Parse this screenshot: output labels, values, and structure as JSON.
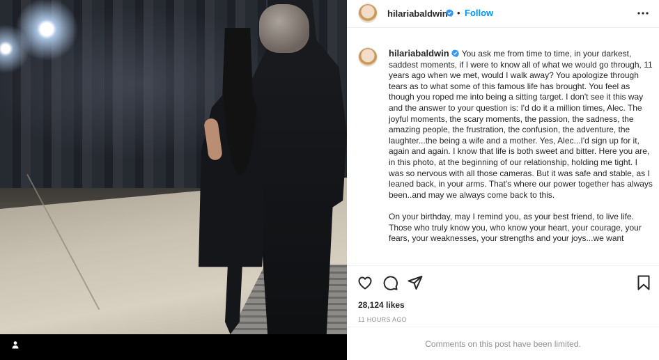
{
  "post": {
    "username": "hilariabaldwin",
    "follow_label": "Follow",
    "separator": "•",
    "caption": "You ask me from time to time, in your darkest, saddest moments, if I were to know all of what we would go through, 11 years ago when we met, would I walk away? You apologize through tears as to what some of this famous life has brought. You feel as though you roped me into being a sitting target. I don't see it this way and the answer to your question is: I'd do it a million times, Alec. The joyful moments, the scary moments, the passion, the sadness, the amazing people, the frustration, the confusion, the adventure, the laughter...the being a wife and a mother. Yes, Alec...I'd sign up for it, again and again. I know that life is both sweet and bitter. Here you are, in this photo, at the beginning of our relationship, holding me tight. I was so nervous with all those cameras. But it was safe and stable, as I leaned back, in your arms. That's where our power together has always been..and may we always come back to this.\n\nOn your birthday, may I remind you, as your best friend, to live life. Those who truly know you, who know your heart, your courage, your fears, your weaknesses, your strengths and your joys...we want",
    "likes": "28,124 likes",
    "time_ago": "11 HOURS AGO",
    "comments_notice": "Comments on this post have been limited."
  },
  "icons": {
    "verified": "verified-badge-icon",
    "more": "more-options-icon",
    "like": "heart-icon",
    "comment": "comment-icon",
    "share": "paper-plane-icon",
    "save": "bookmark-icon",
    "tag": "user-tag-icon"
  },
  "colors": {
    "accent": "#0095f6",
    "text": "#262626",
    "muted": "#8e8e8e",
    "border": "#efefef",
    "media_bg": "#000000"
  }
}
